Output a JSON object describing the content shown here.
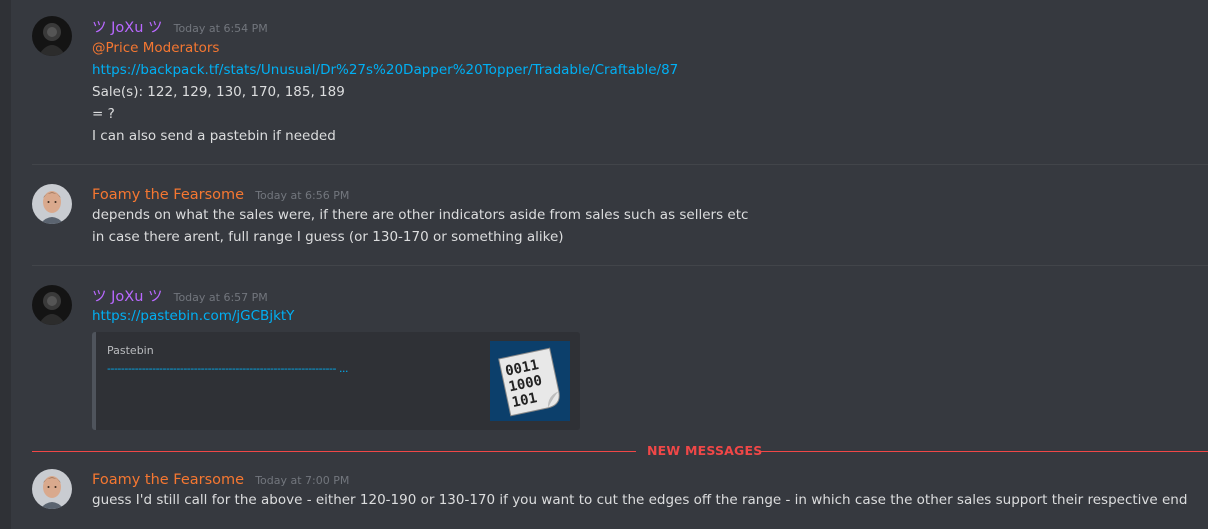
{
  "messages": [
    {
      "author": "ツ JoXu ツ",
      "timestamp": "Today at 6:54 PM",
      "lines": {
        "mention": "@Price Moderators",
        "link": "https://backpack.tf/stats/Unusual/Dr%27s%20Dapper%20Topper/Tradable/Craftable/87",
        "sales": "Sale(s): 122, 129, 130, 170, 185, 189",
        "q": "= ?",
        "pastebin_offer": "I can also send a pastebin if needed"
      }
    },
    {
      "author": "Foamy the Fearsome",
      "timestamp": "Today at 6:56 PM",
      "lines": {
        "l1": "depends on what the sales were, if there are other indicators aside from sales such as sellers etc",
        "l2": "in case there arent, full range I guess (or 130-170 or something alike)"
      }
    },
    {
      "author": "ツ JoXu ツ",
      "timestamp": "Today at 6:57 PM",
      "lines": {
        "link": "https://pastebin.com/jGCBjktY"
      },
      "embed": {
        "provider": "Pastebin",
        "title": "------------------------------------------------------------------ ...",
        "thumb_text": [
          "0011",
          "1000",
          "101"
        ]
      }
    },
    {
      "author": "Foamy the Fearsome",
      "timestamp": "Today at 7:00 PM",
      "lines": {
        "l1": "guess I'd still call for the above - either 120-190 or 130-170 if you want to cut the edges off the range - in which case the other sales support their respective end"
      }
    }
  ],
  "new_messages_label": "NEW MESSAGES",
  "colors": {
    "background": "#36393f",
    "joxu_name": "#b968ff",
    "foamy_name": "#f57731",
    "link": "#00b0f4",
    "new_messages": "#f04747"
  },
  "icons": {
    "avatar_joxu": "dark-silhouette-avatar",
    "avatar_foamy": "man-portrait-avatar",
    "embed_thumb": "binary-paper-icon"
  }
}
